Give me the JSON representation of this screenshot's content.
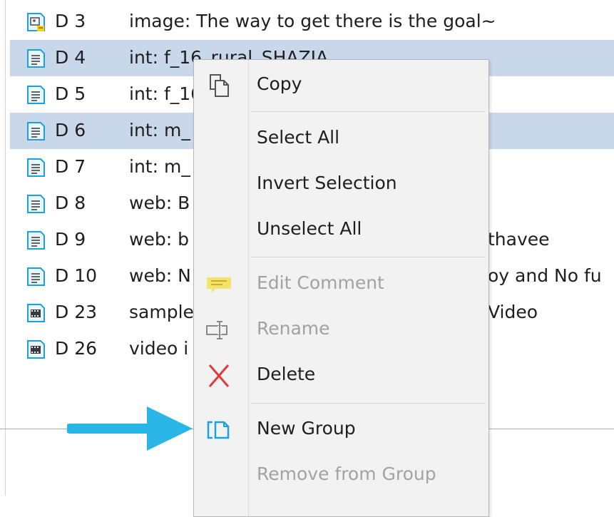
{
  "documents": [
    {
      "code": "D 3",
      "title": "image: The way to get there is the goal~",
      "icon": "image-document-icon",
      "selected": false
    },
    {
      "code": "D 4",
      "title": "int: f_16_rural_SHAZIA",
      "icon": "text-document-icon",
      "selected": true
    },
    {
      "code": "D 5",
      "title": "int: f_16",
      "icon": "text-document-icon",
      "selected": false
    },
    {
      "code": "D 6",
      "title": "int: m_",
      "icon": "text-document-icon",
      "selected": true
    },
    {
      "code": "D 7",
      "title": "int: m_",
      "icon": "text-document-icon",
      "selected": false
    },
    {
      "code": "D 8",
      "title": "web: B",
      "icon": "text-document-icon",
      "selected": false
    },
    {
      "code": "D 9",
      "title": "web: b",
      "tail": "thavee",
      "icon": "text-document-icon",
      "selected": false
    },
    {
      "code": "D 10",
      "title": "web: N",
      "tail": "oy and No fu",
      "icon": "text-document-icon",
      "selected": false
    },
    {
      "code": "D 23",
      "title": "sample",
      "tail": "Video",
      "icon": "video-document-icon",
      "selected": false
    },
    {
      "code": "D 26",
      "title": "video i",
      "icon": "video-document-icon",
      "selected": false
    }
  ],
  "context_menu": {
    "copy": "Copy",
    "select_all": "Select All",
    "invert_selection": "Invert Selection",
    "unselect_all": "Unselect All",
    "edit_comment": "Edit Comment",
    "rename": "Rename",
    "delete": "Delete",
    "new_group": "New Group",
    "remove_from_group": "Remove from Group"
  },
  "colors": {
    "selection": "#c8d8ea",
    "arrow": "#29b6e6",
    "delete_icon": "#e03a3a",
    "icon_accent": "#1ba1e2"
  }
}
